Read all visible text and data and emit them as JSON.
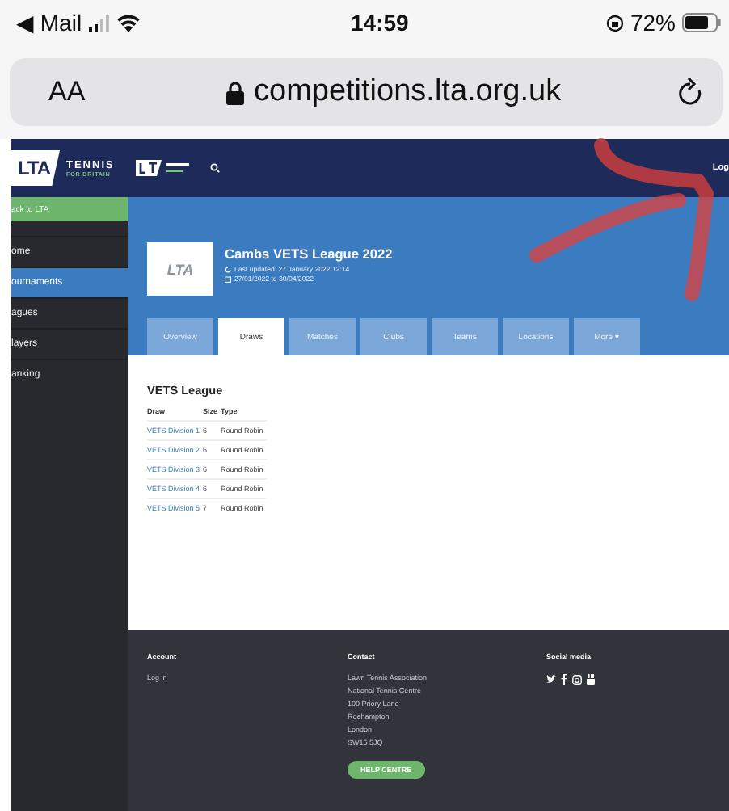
{
  "status_bar": {
    "back_label": "◀ Mail",
    "time": "14:59",
    "battery": "72%"
  },
  "browser": {
    "text_size_button": "AA",
    "url": "competitions.lta.org.uk"
  },
  "sidebar": {
    "logo_mark": "LTA",
    "logo_title": "TENNIS",
    "logo_subtitle": "FOR BRITAIN",
    "back_link": "ack to LTA",
    "items": [
      {
        "label": "ome",
        "selected": false
      },
      {
        "label": "ournaments",
        "selected": true
      },
      {
        "label": "agues",
        "selected": false
      },
      {
        "label": "layers",
        "selected": false
      },
      {
        "label": "anking",
        "selected": false
      }
    ]
  },
  "header": {
    "login": "Log"
  },
  "event": {
    "logo_mark": "LTA",
    "title": "Cambs VETS League 2022",
    "last_updated": "Last updated: 27 January 2022 12:14",
    "dates": "27/01/2022 to 30/04/2022"
  },
  "tabs": [
    {
      "label": "Overview",
      "selected": false
    },
    {
      "label": "Draws",
      "selected": true
    },
    {
      "label": "Matches",
      "selected": false
    },
    {
      "label": "Clubs",
      "selected": false
    },
    {
      "label": "Teams",
      "selected": false
    },
    {
      "label": "Locations",
      "selected": false
    },
    {
      "label": "More ▾",
      "selected": false
    }
  ],
  "draws": {
    "heading": "VETS League",
    "columns": [
      "Draw",
      "Size",
      "Type"
    ],
    "rows": [
      [
        "VETS Division 1",
        "6",
        "Round Robin"
      ],
      [
        "VETS Division 2",
        "6",
        "Round Robin"
      ],
      [
        "VETS Division 3",
        "6",
        "Round Robin"
      ],
      [
        "VETS Division 4",
        "6",
        "Round Robin"
      ],
      [
        "VETS Division 5",
        "7",
        "Round Robin"
      ]
    ]
  },
  "footer": {
    "account": {
      "heading": "Account",
      "links": [
        "Log in"
      ]
    },
    "contact": {
      "heading": "Contact",
      "lines": [
        "Lawn Tennis Association",
        "National Tennis Centre",
        "100 Priory Lane",
        "Roehampton",
        "London",
        "SW15 5JQ"
      ],
      "button": "HELP CENTRE"
    },
    "social": {
      "heading": "Social media"
    }
  }
}
